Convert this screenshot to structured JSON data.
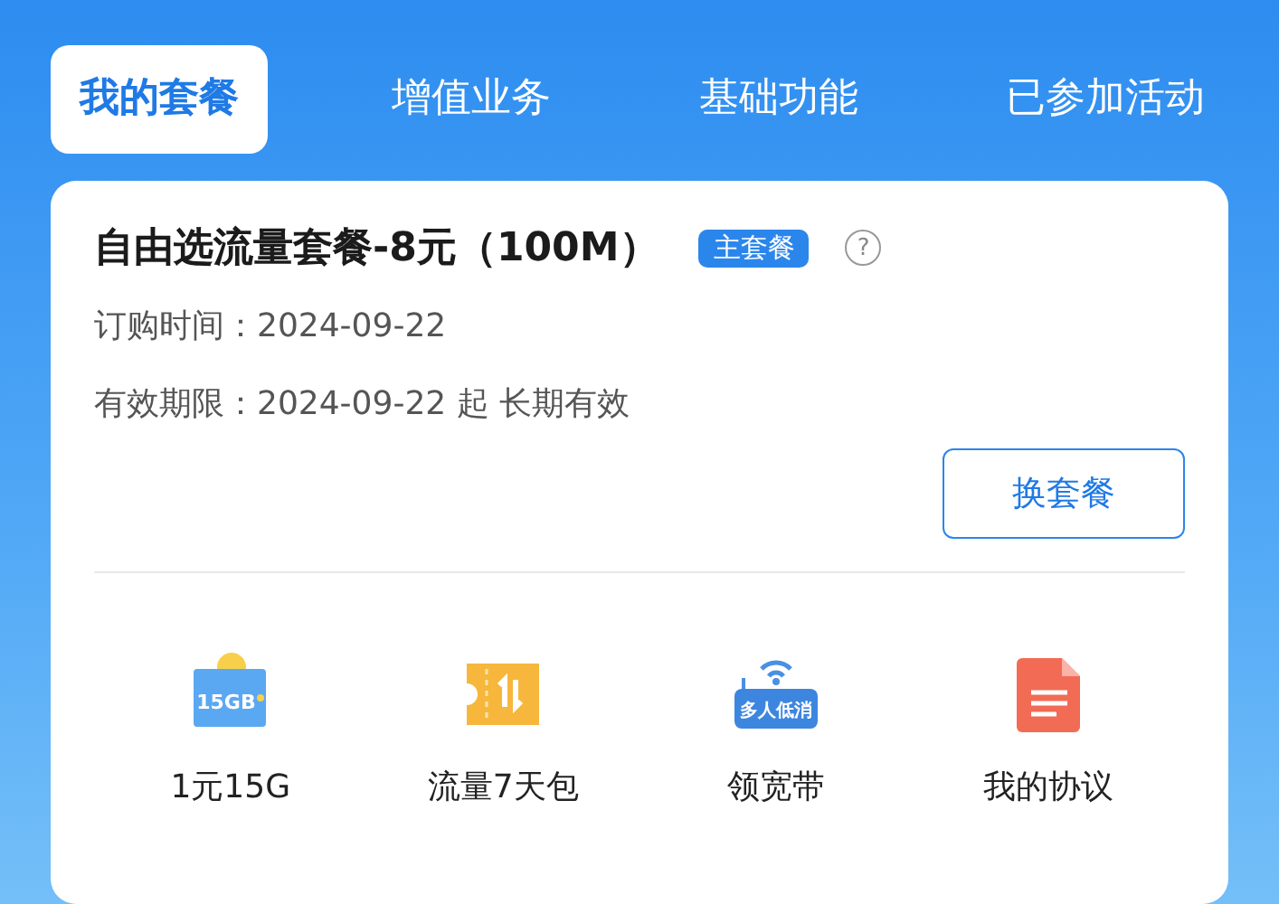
{
  "tabs": [
    {
      "label": "我的套餐",
      "selected": true
    },
    {
      "label": "增值业务",
      "selected": false
    },
    {
      "label": "基础功能",
      "selected": false
    },
    {
      "label": "已参加活动",
      "selected": false
    }
  ],
  "plan": {
    "title": "自由选流量套餐-8元（100M）",
    "badge": "主套餐",
    "help": "?",
    "details": [
      "订购时间：2024-09-22",
      "有效期限：2024-09-22 起 长期有效"
    ],
    "button": "换套餐"
  },
  "shortcuts": [
    {
      "kind": "sim",
      "icon_text": "15GB",
      "label": "1元15G"
    },
    {
      "kind": "ticket",
      "label": "流量7天包"
    },
    {
      "kind": "router",
      "icon_text": "多人低消",
      "label": "领宽带"
    },
    {
      "kind": "document",
      "label": "我的协议"
    }
  ]
}
